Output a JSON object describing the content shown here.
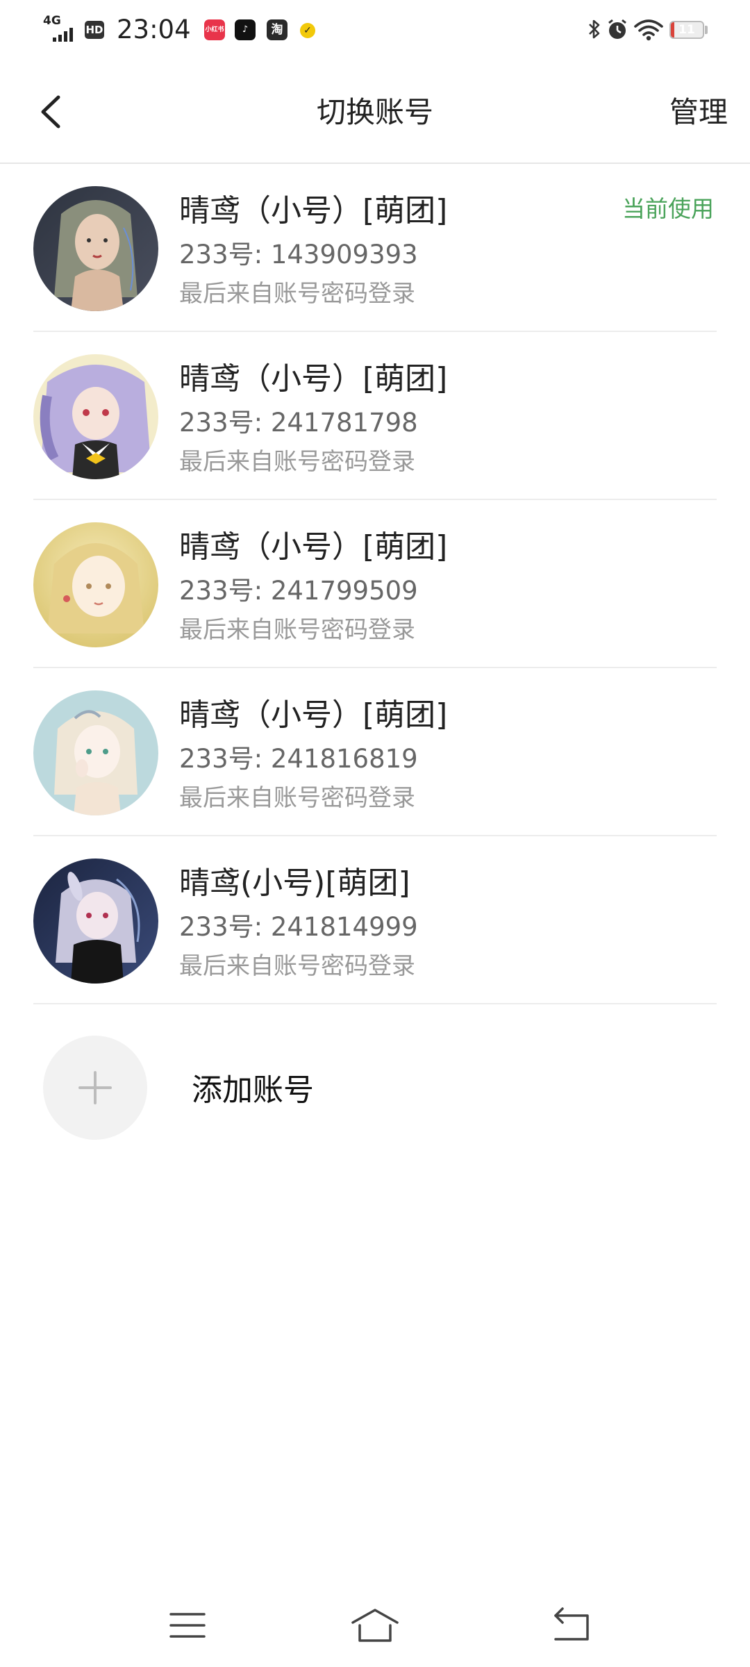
{
  "status_bar": {
    "network": "4G",
    "hd": "HD",
    "time": "23:04",
    "apps": [
      {
        "name": "xiaohongshu",
        "glyph": "小红书"
      },
      {
        "name": "douyin",
        "glyph": "♪"
      },
      {
        "name": "taobao",
        "glyph": "淘"
      },
      {
        "name": "yellow-app",
        "glyph": "✓"
      }
    ],
    "battery_level": "11",
    "battery_percent": 11,
    "battery_color": "#d9433a"
  },
  "header": {
    "title": "切换账号",
    "manage_label": "管理"
  },
  "accounts": [
    {
      "name": "晴鸢（小号）[萌团]",
      "id_text": "233号: 143909393",
      "last_login": "最后来自账号密码登录",
      "current_label": "当前使用"
    },
    {
      "name": "晴鸢（小号）[萌团]",
      "id_text": "233号: 241781798",
      "last_login": "最后来自账号密码登录"
    },
    {
      "name": "晴鸢（小号）[萌团]",
      "id_text": "233号: 241799509",
      "last_login": "最后来自账号密码登录"
    },
    {
      "name": "晴鸢（小号）[萌团]",
      "id_text": "233号: 241816819",
      "last_login": "最后来自账号密码登录"
    },
    {
      "name": "晴鸢(小号)[萌团]",
      "id_text": "233号: 241814999",
      "last_login": "最后来自账号密码登录"
    }
  ],
  "add_account": {
    "label": "添加账号"
  },
  "colors": {
    "accent_green": "#4aa35a",
    "divider": "#ececec"
  }
}
